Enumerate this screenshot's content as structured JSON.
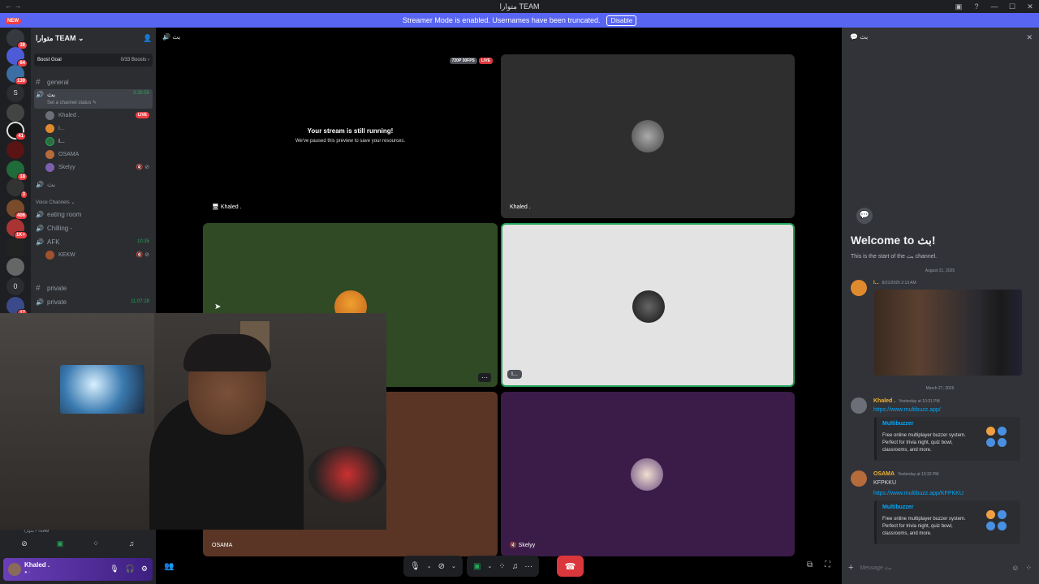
{
  "titlebar": {
    "title": "متوارا TEAM",
    "back": "←  →"
  },
  "streamer": {
    "message": "Streamer Mode is enabled. Usernames have been truncated.",
    "disable": "Disable"
  },
  "rail": {
    "new_label": "NEW",
    "servers": [
      {
        "badge": "38"
      },
      {
        "badge": "64"
      },
      {
        "badge": "130"
      },
      {
        "badge": ""
      },
      {
        "badge": ""
      },
      {
        "badge": "41"
      },
      {
        "badge": ""
      },
      {
        "badge": "18"
      },
      {
        "badge": "3"
      },
      {
        "badge": "406"
      },
      {
        "badge": "1K+"
      },
      {
        "badge": ""
      },
      {
        "badge": ""
      },
      {
        "badge": ""
      },
      {
        "badge": "17"
      }
    ],
    "letter_s": "S",
    "zero": "0"
  },
  "sidebar": {
    "guild_name": "متوارا TEAM",
    "boost_label": "Boost Goal",
    "boost_count": "0/33 Boosts ›",
    "ch_general": "general",
    "ch_voice_active": "بث",
    "ch_voice_active_time": "3:38:56",
    "ch_voice_active_status": "Set a channel status ✎",
    "voice_users": [
      {
        "name": "Khaled .",
        "tag": "LIVE"
      },
      {
        "name": "I...",
        "tag": ""
      },
      {
        "name": "I...",
        "tag": ""
      },
      {
        "name": "OSAMA",
        "tag": ""
      },
      {
        "name": "Skelyy",
        "tag": "🔇 ⊘"
      }
    ],
    "ch_voice2": "بث",
    "category": "Voice Channels ⌄",
    "ch_eating": "eating room",
    "ch_chilling": "Chilling -",
    "ch_afk": "AFK",
    "ch_afk_time": "10:35",
    "afk_user": "KEKW",
    "ch_private": "private",
    "ch_private_voice": "private",
    "ch_private_time": "11:07:28"
  },
  "userpanel": {
    "username": "Khaled .",
    "status": "● ◦",
    "small_label": "متوارا • TEAM"
  },
  "stage": {
    "header": "بث",
    "resolution": "720P 30FPS",
    "live": "LIVE",
    "paused_title": "Your stream is still running!",
    "paused_sub": "We've paused this preview to save your resources.",
    "tile1_name": "Khaled .",
    "tile2_name": "Khaled .",
    "tile4_name": "I...",
    "tile5_name": "OSAMA",
    "tile6_name": "Skelyy",
    "more": "···"
  },
  "chat": {
    "header": "بث",
    "welcome": "Welcome to بث!",
    "welcome_sub": "This is the start of the بث channel.",
    "date1": "August 21, 2025",
    "msg1_name": "I...",
    "msg1_time": "8/21/2025 2:13 AM",
    "date2": "March 27, 2026",
    "msg2_name": "Khaled .",
    "msg2_time": "Yesterday at 10:31 PM",
    "msg2_link": "https://www.multibuzz.app/",
    "embed_title": "Multibuzzer",
    "embed_desc": "Free online multiplayer buzzer system. Perfect for trivia night, quiz bowl, classrooms, and more.",
    "msg3_name": "OSAMA",
    "msg3_time": "Yesterday at 10:32 PM",
    "msg3_text": "KFPKKU",
    "msg3_link": "https://www.multibuzz.app/KFPKKU",
    "composer_placeholder": "Message بث"
  },
  "colors": {
    "blurple": "#5865f2",
    "green": "#23a55a",
    "red": "#da373c",
    "link": "#00a8fc",
    "osama": "#f0b232",
    "khaled": "#f0b232"
  }
}
